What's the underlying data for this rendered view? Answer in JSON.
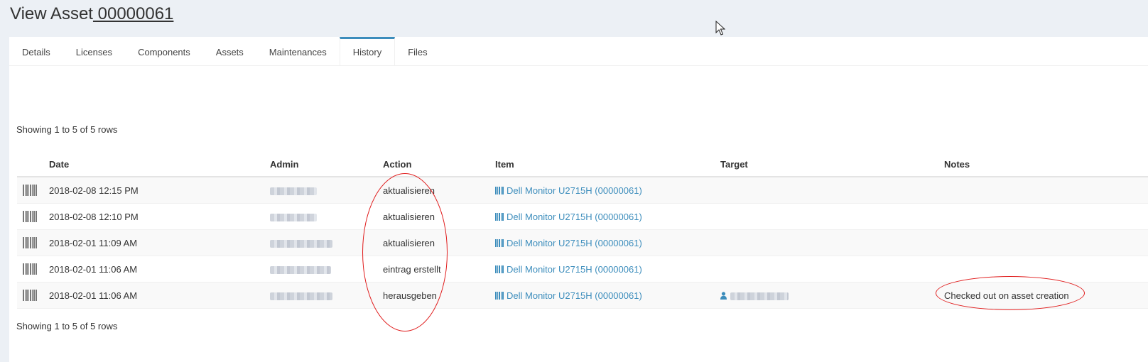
{
  "header": {
    "title_prefix": "View Asset",
    "asset_tag": " 00000061"
  },
  "tabs": [
    {
      "label": "Details"
    },
    {
      "label": "Licenses"
    },
    {
      "label": "Components"
    },
    {
      "label": "Assets"
    },
    {
      "label": "Maintenances"
    },
    {
      "label": "History",
      "active": true
    },
    {
      "label": "Files"
    }
  ],
  "pagination": {
    "top": "Showing 1 to 5 of 5 rows",
    "bottom": "Showing 1 to 5 of 5 rows"
  },
  "table": {
    "columns": [
      "Date",
      "Admin",
      "Action",
      "Item",
      "Target",
      "Notes"
    ],
    "rows": [
      {
        "date": "2018-02-08 12:15 PM",
        "action": "aktualisieren",
        "item": "Dell Monitor U2715H (00000061)",
        "notes": ""
      },
      {
        "date": "2018-02-08 12:10 PM",
        "action": "aktualisieren",
        "item": "Dell Monitor U2715H (00000061)",
        "notes": ""
      },
      {
        "date": "2018-02-01 11:09 AM",
        "action": "aktualisieren",
        "item": "Dell Monitor U2715H (00000061)",
        "notes": ""
      },
      {
        "date": "2018-02-01 11:06 AM",
        "action": "eintrag erstellt",
        "item": "Dell Monitor U2715H (00000061)",
        "notes": ""
      },
      {
        "date": "2018-02-01 11:06 AM",
        "action": "herausgeben",
        "item": "Dell Monitor U2715H (00000061)",
        "notes": "Checked out on asset creation"
      }
    ]
  },
  "colors": {
    "link": "#3c8dbc",
    "annotation": "#e01b1b",
    "page_bg": "#ecf0f5"
  }
}
